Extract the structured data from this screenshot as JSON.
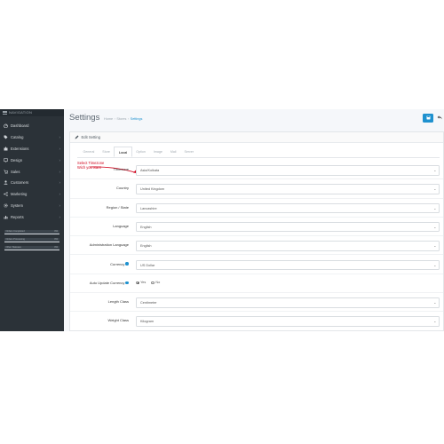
{
  "sidebar": {
    "nav_title": "NAVIGATION",
    "items": [
      {
        "label": "Dashboard",
        "icon": "dashboard-icon",
        "has_children": false
      },
      {
        "label": "Catalog",
        "icon": "tag-icon",
        "has_children": true
      },
      {
        "label": "Extensions",
        "icon": "puzzle-icon",
        "has_children": true
      },
      {
        "label": "Design",
        "icon": "monitor-icon",
        "has_children": true
      },
      {
        "label": "Sales",
        "icon": "cart-icon",
        "has_children": true
      },
      {
        "label": "Customers",
        "icon": "user-icon",
        "has_children": true
      },
      {
        "label": "Marketing",
        "icon": "share-icon",
        "has_children": true
      },
      {
        "label": "System",
        "icon": "gear-icon",
        "has_children": true
      },
      {
        "label": "Reports",
        "icon": "bar-chart-icon",
        "has_children": true
      }
    ],
    "progress": [
      {
        "label": "Orders Completed",
        "value": "0%"
      },
      {
        "label": "Orders Processing",
        "value": "0%"
      },
      {
        "label": "Other Statuses",
        "value": "0%"
      }
    ]
  },
  "header": {
    "title": "Settings",
    "breadcrumb": [
      "Home",
      "Stores",
      "Settings"
    ]
  },
  "panel": {
    "heading": "Edit Setting",
    "tabs": [
      "General",
      "Store",
      "Local",
      "Option",
      "Image",
      "Mail",
      "Server"
    ],
    "active_tab": "Local"
  },
  "annotation": {
    "line1": "Select Timezone",
    "line2": "Wich you want"
  },
  "form": {
    "timezone": {
      "label": "Timezone",
      "value": "Asia/Kolkata"
    },
    "country": {
      "label": "Country",
      "value": "United Kingdom"
    },
    "region": {
      "label": "Region / State",
      "value": "Lancashire"
    },
    "language": {
      "label": "Language",
      "value": "English"
    },
    "admin_language": {
      "label": "Administration Language",
      "value": "English"
    },
    "currency": {
      "label": "Currency",
      "value": "US Dollar"
    },
    "auto_update": {
      "label": "Auto Update Currency",
      "yes": "Yes",
      "no": "No",
      "selected": "Yes"
    },
    "length_class": {
      "label": "Length Class",
      "value": "Centimeter"
    },
    "weight_class": {
      "label": "Weight Class",
      "value": "Kilogram"
    }
  },
  "colors": {
    "sidebar_bg": "#2b3238",
    "accent": "#1e91cf",
    "annotation": "#d0021b"
  }
}
